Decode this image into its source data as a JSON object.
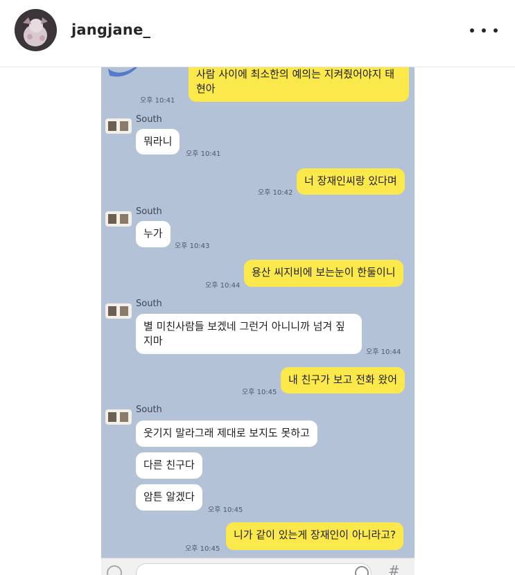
{
  "header": {
    "username": "jangjane_",
    "more_icon": "more-horizontal-icon"
  },
  "colors": {
    "chat_background": "#b4c2d7",
    "my_bubble": "#fbe84a",
    "their_bubble": "#ffffff"
  },
  "chat": {
    "top_bubble": {
      "line1": "사람 사이에 최소한의 예의는 지켜줬어야지 태",
      "line2": "현아",
      "time": "오후 10:41"
    },
    "groups": [
      {
        "sender": "South",
        "bubbles": [
          "뭐라니"
        ],
        "time": "오후 10:41"
      },
      {
        "sender": "South",
        "bubbles": [
          "누가"
        ],
        "time": "오후 10:43"
      },
      {
        "sender": "South",
        "line1": "별 미친사람들 보겠네 그런거 아니니까 넘겨 짚",
        "line2": "지마",
        "time": "오후 10:44"
      },
      {
        "sender": "South",
        "bubbles": [
          "웃기지 말라그래 제대로 보지도 못하고",
          "다른 친구다",
          "암튼 알겠다"
        ],
        "time": "오후 10:45"
      }
    ],
    "mine": [
      {
        "text": "너 장재인씨랑 있다며",
        "time": "오후 10:42"
      },
      {
        "text": "용산 씨지비에 보는눈이 한둘이니",
        "time": "오후 10:44"
      },
      {
        "text": "내 친구가 보고 전화 왔어",
        "time": "오후 10:45"
      },
      {
        "text": "니가 같이 있는게 장재인이 아니라고?",
        "time": "오후 10:45"
      }
    ]
  },
  "inputbar": {
    "hash_symbol": "#"
  }
}
